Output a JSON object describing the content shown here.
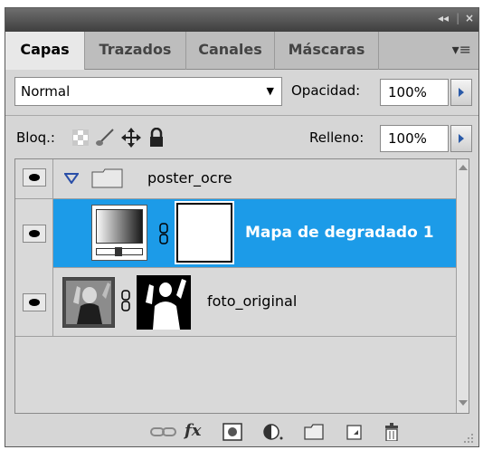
{
  "titlebar": {
    "collapse_glyph": "◂◂",
    "close_glyph": "×"
  },
  "tabs": [
    {
      "label": "Capas",
      "active": true
    },
    {
      "label": "Trazados",
      "active": false
    },
    {
      "label": "Canales",
      "active": false
    },
    {
      "label": "Máscaras",
      "active": false
    }
  ],
  "panel_menu_glyph": "▾≡",
  "blend": {
    "mode": "Normal",
    "arrow": "▼"
  },
  "opacity": {
    "label": "Opacidad:",
    "value": "100%"
  },
  "lock": {
    "label": "Bloq.:",
    "icons": [
      "lock-transparent-pixels-icon",
      "lock-image-pixels-icon",
      "lock-position-icon",
      "lock-all-icon"
    ]
  },
  "fill": {
    "label": "Relleno:",
    "value": "100%"
  },
  "layers": [
    {
      "name": "poster_ocre",
      "type": "group",
      "expanded": true,
      "visible": true
    },
    {
      "name": "Mapa de degradado 1",
      "type": "gradient-map-adjustment",
      "selected": true,
      "visible": true
    },
    {
      "name": "foto_original",
      "type": "pixel-with-mask",
      "visible": true
    }
  ],
  "bottom_tools": [
    "link-layers-icon",
    "fx-icon",
    "add-mask-icon",
    "adjustment-layer-icon",
    "new-group-icon",
    "new-layer-icon",
    "trash-icon"
  ],
  "fx_label": "fx",
  "colors": {
    "selection": "#1c9be8",
    "panel": "#d6d6d6",
    "titlebar": "#4a4a4a"
  }
}
